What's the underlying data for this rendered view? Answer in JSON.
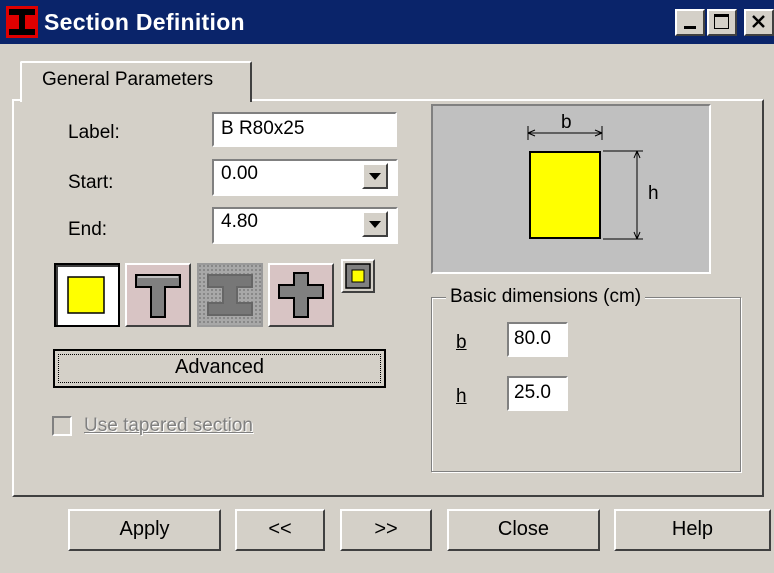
{
  "window": {
    "title": "Section Definition",
    "icon": "i-beam-app-icon",
    "controls": [
      "minimize",
      "maximize",
      "close"
    ]
  },
  "tabs": [
    {
      "label": "General Parameters",
      "active": true
    }
  ],
  "form": {
    "label": {
      "caption": "Label:",
      "value": "B R80x25"
    },
    "start": {
      "caption": "Start:",
      "value": "0.00"
    },
    "end": {
      "caption": "End:",
      "value": "4.80"
    }
  },
  "section_types": [
    {
      "name": "rectangular",
      "icon": "rectangle-section-icon",
      "selected": true,
      "enabled": true
    },
    {
      "name": "t-section",
      "icon": "t-section-icon",
      "selected": false,
      "enabled": true
    },
    {
      "name": "i-section",
      "icon": "i-section-icon",
      "selected": false,
      "enabled": false
    },
    {
      "name": "cross-section",
      "icon": "cross-section-icon",
      "selected": false,
      "enabled": true
    },
    {
      "name": "hollow-box",
      "icon": "box-section-icon",
      "selected": false,
      "enabled": true
    }
  ],
  "advanced_label": "Advanced",
  "tapered": {
    "label": "Use tapered section",
    "checked": false,
    "enabled": false
  },
  "preview": {
    "b_label": "b",
    "h_label": "h",
    "fill_color": "#ffff00"
  },
  "basic_dimensions": {
    "title": "Basic dimensions (cm)",
    "b": {
      "label": "b",
      "value": "80.0"
    },
    "h": {
      "label": "h",
      "value": "25.0"
    }
  },
  "buttons": {
    "apply": "Apply",
    "prev": "<<",
    "next": ">>",
    "close": "Close",
    "help": "Help"
  }
}
